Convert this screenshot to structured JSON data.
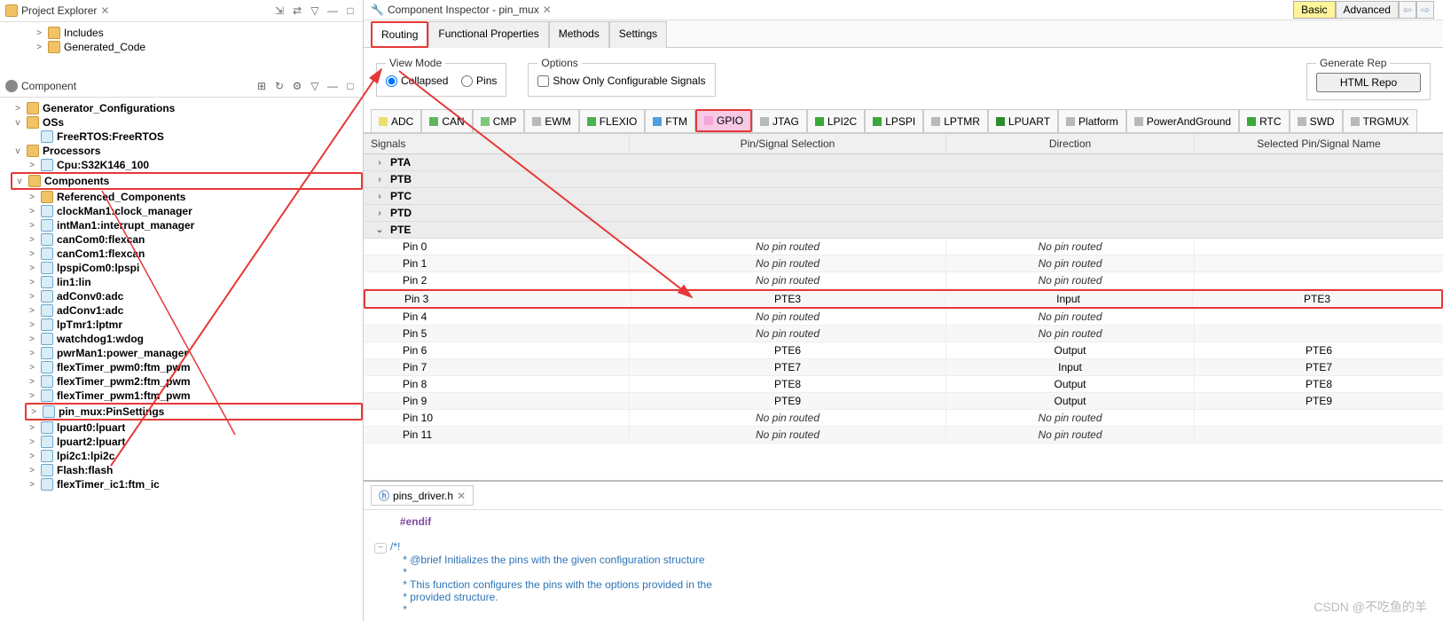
{
  "project_explorer": {
    "title": "Project Explorer",
    "tree": [
      {
        "label": "Includes",
        "arrow": ">",
        "icon": "folder",
        "indent": 1
      },
      {
        "label": "Generated_Code",
        "arrow": ">",
        "icon": "folder",
        "indent": 1
      }
    ]
  },
  "components_view": {
    "title": "Component",
    "tree": [
      {
        "label": "Generator_Configurations",
        "arrow": ">",
        "icon": "folder",
        "bold": true,
        "indent": 0
      },
      {
        "label": "OSs",
        "arrow": "v",
        "icon": "folder",
        "bold": true,
        "indent": 0
      },
      {
        "label": "FreeRTOS:FreeRTOS",
        "arrow": "",
        "icon": "cmp",
        "bold": true,
        "indent": 1
      },
      {
        "label": "Processors",
        "arrow": "v",
        "icon": "folder",
        "bold": true,
        "indent": 0
      },
      {
        "label": "Cpu:S32K146_100",
        "arrow": ">",
        "icon": "cmp",
        "bold": true,
        "indent": 1
      },
      {
        "label": "Components",
        "arrow": "v",
        "icon": "folder",
        "bold": true,
        "indent": 0,
        "highlight": true
      },
      {
        "label": "Referenced_Components",
        "arrow": ">",
        "icon": "folder",
        "bold": true,
        "indent": 1
      },
      {
        "label": "clockMan1:clock_manager",
        "arrow": ">",
        "icon": "cmp",
        "bold": true,
        "indent": 1
      },
      {
        "label": "intMan1:interrupt_manager",
        "arrow": ">",
        "icon": "cmp",
        "bold": true,
        "indent": 1
      },
      {
        "label": "canCom0:flexcan",
        "arrow": ">",
        "icon": "cmp",
        "bold": true,
        "indent": 1
      },
      {
        "label": "canCom1:flexcan",
        "arrow": ">",
        "icon": "cmp",
        "bold": true,
        "indent": 1
      },
      {
        "label": "lpspiCom0:lpspi",
        "arrow": ">",
        "icon": "cmp",
        "bold": true,
        "indent": 1
      },
      {
        "label": "lin1:lin",
        "arrow": ">",
        "icon": "cmp",
        "bold": true,
        "indent": 1
      },
      {
        "label": "adConv0:adc",
        "arrow": ">",
        "icon": "cmp",
        "bold": true,
        "indent": 1
      },
      {
        "label": "adConv1:adc",
        "arrow": ">",
        "icon": "cmp",
        "bold": true,
        "indent": 1
      },
      {
        "label": "lpTmr1:lptmr",
        "arrow": ">",
        "icon": "cmp",
        "bold": true,
        "indent": 1
      },
      {
        "label": "watchdog1:wdog",
        "arrow": ">",
        "icon": "cmp",
        "bold": true,
        "indent": 1
      },
      {
        "label": "pwrMan1:power_manager",
        "arrow": ">",
        "icon": "cmp",
        "bold": true,
        "indent": 1
      },
      {
        "label": "flexTimer_pwm0:ftm_pwm",
        "arrow": ">",
        "icon": "cmp",
        "bold": true,
        "indent": 1
      },
      {
        "label": "flexTimer_pwm2:ftm_pwm",
        "arrow": ">",
        "icon": "cmp",
        "bold": true,
        "indent": 1
      },
      {
        "label": "flexTimer_pwm1:ftm_pwm",
        "arrow": ">",
        "icon": "cmp",
        "bold": true,
        "indent": 1
      },
      {
        "label": "pin_mux:PinSettings",
        "arrow": ">",
        "icon": "cmp",
        "bold": true,
        "indent": 1,
        "highlight": true
      },
      {
        "label": "lpuart0:lpuart",
        "arrow": ">",
        "icon": "cmp",
        "bold": true,
        "indent": 1
      },
      {
        "label": "lpuart2:lpuart",
        "arrow": ">",
        "icon": "cmp",
        "bold": true,
        "indent": 1
      },
      {
        "label": "lpi2c1:lpi2c",
        "arrow": ">",
        "icon": "cmp",
        "bold": true,
        "indent": 1
      },
      {
        "label": "Flash:flash",
        "arrow": ">",
        "icon": "cmp",
        "bold": true,
        "indent": 1
      },
      {
        "label": "flexTimer_ic1:ftm_ic",
        "arrow": ">",
        "icon": "cmp",
        "bold": true,
        "indent": 1
      }
    ]
  },
  "inspector": {
    "title": "Component Inspector - pin_mux",
    "mode_basic": "Basic",
    "mode_adv": "Advanced",
    "subtabs": [
      "Routing",
      "Functional Properties",
      "Methods",
      "Settings"
    ],
    "active_subtab": "Routing",
    "view_mode_legend": "View Mode",
    "collapsed": "Collapsed",
    "pins": "Pins",
    "options_legend": "Options",
    "show_only": "Show Only Configurable Signals",
    "generate_legend": "Generate Rep",
    "generate_btn": "HTML Repo",
    "filters": [
      {
        "name": "ADC",
        "c": "#e8e16b"
      },
      {
        "name": "CAN",
        "c": "#5fb65f"
      },
      {
        "name": "CMP",
        "c": "#7cc97c"
      },
      {
        "name": "EWM",
        "c": "#b9b9b9"
      },
      {
        "name": "FLEXIO",
        "c": "#4caf50"
      },
      {
        "name": "FTM",
        "c": "#4f9fe0"
      },
      {
        "name": "GPIO",
        "c": "#f4a7d6",
        "active": true,
        "highlight": true
      },
      {
        "name": "JTAG",
        "c": "#b9b9b9"
      },
      {
        "name": "LPI2C",
        "c": "#3aa83a"
      },
      {
        "name": "LPSPI",
        "c": "#3aa83a"
      },
      {
        "name": "LPTMR",
        "c": "#b9b9b9"
      },
      {
        "name": "LPUART",
        "c": "#2e8b2e"
      },
      {
        "name": "Platform",
        "c": "#b9b9b9"
      },
      {
        "name": "PowerAndGround",
        "c": "#b9b9b9"
      },
      {
        "name": "RTC",
        "c": "#3aa83a"
      },
      {
        "name": "SWD",
        "c": "#b9b9b9"
      },
      {
        "name": "TRGMUX",
        "c": "#b9b9b9"
      }
    ],
    "grid_headers": {
      "c0": "Signals",
      "c1": "Pin/Signal Selection",
      "c2": "Direction",
      "c3": "Selected Pin/Signal Name"
    },
    "ports": [
      {
        "name": "PTA",
        "open": false
      },
      {
        "name": "PTB",
        "open": false
      },
      {
        "name": "PTC",
        "open": false
      },
      {
        "name": "PTD",
        "open": false
      },
      {
        "name": "PTE",
        "open": true,
        "pins": [
          {
            "label": "Pin 0",
            "sel": "No pin routed",
            "dir": "No pin routed",
            "name": "",
            "it": true
          },
          {
            "label": "Pin 1",
            "sel": "No pin routed",
            "dir": "No pin routed",
            "name": "",
            "it": true
          },
          {
            "label": "Pin 2",
            "sel": "No pin routed",
            "dir": "No pin routed",
            "name": "",
            "it": true
          },
          {
            "label": "Pin 3",
            "sel": "PTE3",
            "dir": "Input",
            "name": "PTE3",
            "highlight": true
          },
          {
            "label": "Pin 4",
            "sel": "No pin routed",
            "dir": "No pin routed",
            "name": "",
            "it": true
          },
          {
            "label": "Pin 5",
            "sel": "No pin routed",
            "dir": "No pin routed",
            "name": "",
            "it": true
          },
          {
            "label": "Pin 6",
            "sel": "PTE6",
            "dir": "Output",
            "name": "PTE6"
          },
          {
            "label": "Pin 7",
            "sel": "PTE7",
            "dir": "Input",
            "name": "PTE7"
          },
          {
            "label": "Pin 8",
            "sel": "PTE8",
            "dir": "Output",
            "name": "PTE8"
          },
          {
            "label": "Pin 9",
            "sel": "PTE9",
            "dir": "Output",
            "name": "PTE9"
          },
          {
            "label": "Pin 10",
            "sel": "No pin routed",
            "dir": "No pin routed",
            "name": "",
            "it": true
          },
          {
            "label": "Pin 11",
            "sel": "No pin routed",
            "dir": "No pin routed",
            "name": "",
            "it": true
          }
        ]
      }
    ]
  },
  "code": {
    "file": "pins_driver.h",
    "endif": "#endif",
    "lines": [
      "/*!",
      " * @brief Initializes the pins with the given configuration structure",
      " *",
      " * This function configures the pins with the options provided in the",
      " * provided structure.",
      " *"
    ]
  },
  "watermark": "CSDN @不吃鱼的羊"
}
